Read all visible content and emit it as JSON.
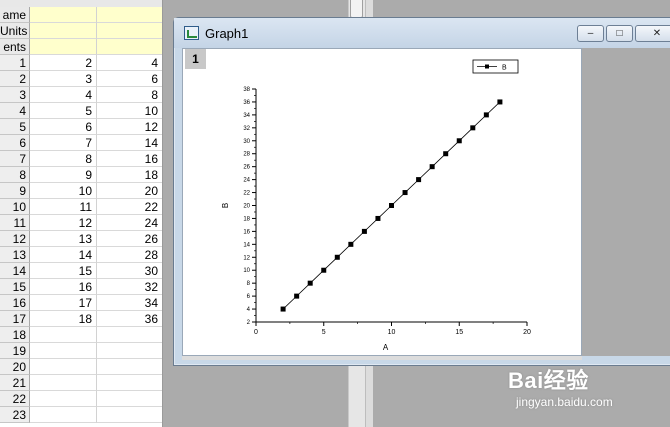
{
  "worksheet": {
    "meta_rows": [
      {
        "label": "ame",
        "a": "",
        "b": ""
      },
      {
        "label": "Units",
        "a": "",
        "b": ""
      },
      {
        "label": "ents",
        "a": "",
        "b": ""
      }
    ],
    "rows": [
      {
        "n": "1",
        "a": "2",
        "b": "4"
      },
      {
        "n": "2",
        "a": "3",
        "b": "6"
      },
      {
        "n": "3",
        "a": "4",
        "b": "8"
      },
      {
        "n": "4",
        "a": "5",
        "b": "10"
      },
      {
        "n": "5",
        "a": "6",
        "b": "12"
      },
      {
        "n": "6",
        "a": "7",
        "b": "14"
      },
      {
        "n": "7",
        "a": "8",
        "b": "16"
      },
      {
        "n": "8",
        "a": "9",
        "b": "18"
      },
      {
        "n": "9",
        "a": "10",
        "b": "20"
      },
      {
        "n": "10",
        "a": "11",
        "b": "22"
      },
      {
        "n": "11",
        "a": "12",
        "b": "24"
      },
      {
        "n": "12",
        "a": "13",
        "b": "26"
      },
      {
        "n": "13",
        "a": "14",
        "b": "28"
      },
      {
        "n": "14",
        "a": "15",
        "b": "30"
      },
      {
        "n": "15",
        "a": "16",
        "b": "32"
      },
      {
        "n": "16",
        "a": "17",
        "b": "34"
      },
      {
        "n": "17",
        "a": "18",
        "b": "36"
      },
      {
        "n": "18",
        "a": "",
        "b": ""
      },
      {
        "n": "19",
        "a": "",
        "b": ""
      },
      {
        "n": "20",
        "a": "",
        "b": ""
      },
      {
        "n": "21",
        "a": "",
        "b": ""
      },
      {
        "n": "22",
        "a": "",
        "b": ""
      },
      {
        "n": "23",
        "a": "",
        "b": ""
      }
    ]
  },
  "graph_window": {
    "title": "Graph1",
    "layer_label": "1",
    "icon": "origin-graph-icon",
    "buttons": {
      "minimize": "minimize-icon",
      "maximize": "maximize-icon",
      "close": "close-icon"
    }
  },
  "chart_data": {
    "type": "line",
    "x": [
      2,
      3,
      4,
      5,
      6,
      7,
      8,
      9,
      10,
      11,
      12,
      13,
      14,
      15,
      16,
      17,
      18
    ],
    "series": [
      {
        "name": "B",
        "values": [
          4,
          6,
          8,
          10,
          12,
          14,
          16,
          18,
          20,
          22,
          24,
          26,
          28,
          30,
          32,
          34,
          36
        ],
        "marker": "square"
      }
    ],
    "xlabel": "A",
    "ylabel": "B",
    "xlim": [
      0,
      20
    ],
    "ylim": [
      2,
      38
    ],
    "xticks": [
      "0",
      "5",
      "10",
      "15",
      "20"
    ],
    "yticks": [
      "2",
      "4",
      "6",
      "8",
      "10",
      "12",
      "14",
      "16",
      "18",
      "20",
      "22",
      "24",
      "26",
      "28",
      "30",
      "32",
      "34",
      "36",
      "38"
    ],
    "legend_position": "top-right",
    "grid": false
  },
  "watermark": {
    "brand": "Bai经验",
    "url": "jingyan.baidu.com"
  }
}
